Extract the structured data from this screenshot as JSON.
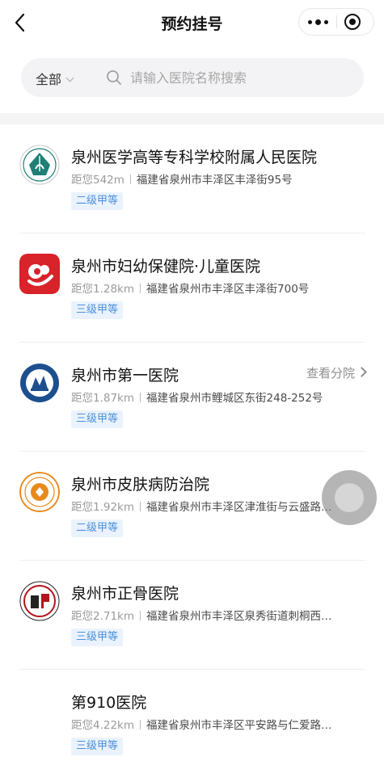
{
  "header": {
    "title": "预约挂号"
  },
  "search": {
    "filter_label": "全部",
    "placeholder": "请输入医院名称搜索",
    "value": ""
  },
  "hospitals": [
    {
      "name": "泉州医学高等专科学校附属人民医院",
      "distance": "距您542m",
      "address": "福建省泉州市丰泽区丰泽街95号",
      "level": "二级甲等",
      "logo_icon": "teal-sail-emblem-icon"
    },
    {
      "name": "泉州市妇幼保健院·儿童医院",
      "distance": "距您1.28km",
      "address": "福建省泉州市丰泽区丰泽街700号",
      "level": "三级甲等",
      "logo_icon": "red-mother-child-icon"
    },
    {
      "name": "泉州市第一医院",
      "distance": "距您1.87km",
      "address": "福建省泉州市鲤城区东街248-252号",
      "level": "三级甲等",
      "branch_label": "查看分院",
      "logo_icon": "blue-round-emblem-icon"
    },
    {
      "name": "泉州市皮肤病防治院",
      "distance": "距您1.92km",
      "address": "福建省泉州市丰泽区津淮街与云盛路…",
      "level": "二级甲等",
      "logo_icon": "orange-round-emblem-icon"
    },
    {
      "name": "泉州市正骨医院",
      "distance": "距您2.71km",
      "address": "福建省泉州市丰泽区泉秀街道刺桐西…",
      "level": "三级甲等",
      "logo_icon": "red-black-seal-icon"
    },
    {
      "name": "第910医院",
      "distance": "距您4.22km",
      "address": "福建省泉州市丰泽区平安路与仁爱路…",
      "level": "三级甲等",
      "logo_icon": ""
    }
  ],
  "colors": {
    "badge_text": "#4a8fdc",
    "badge_bg": "#eaf3fd",
    "logo_red": "#d8232a",
    "logo_teal": "#1f7f77",
    "logo_blue": "#1d4f8f",
    "logo_orange": "#e8891c"
  }
}
